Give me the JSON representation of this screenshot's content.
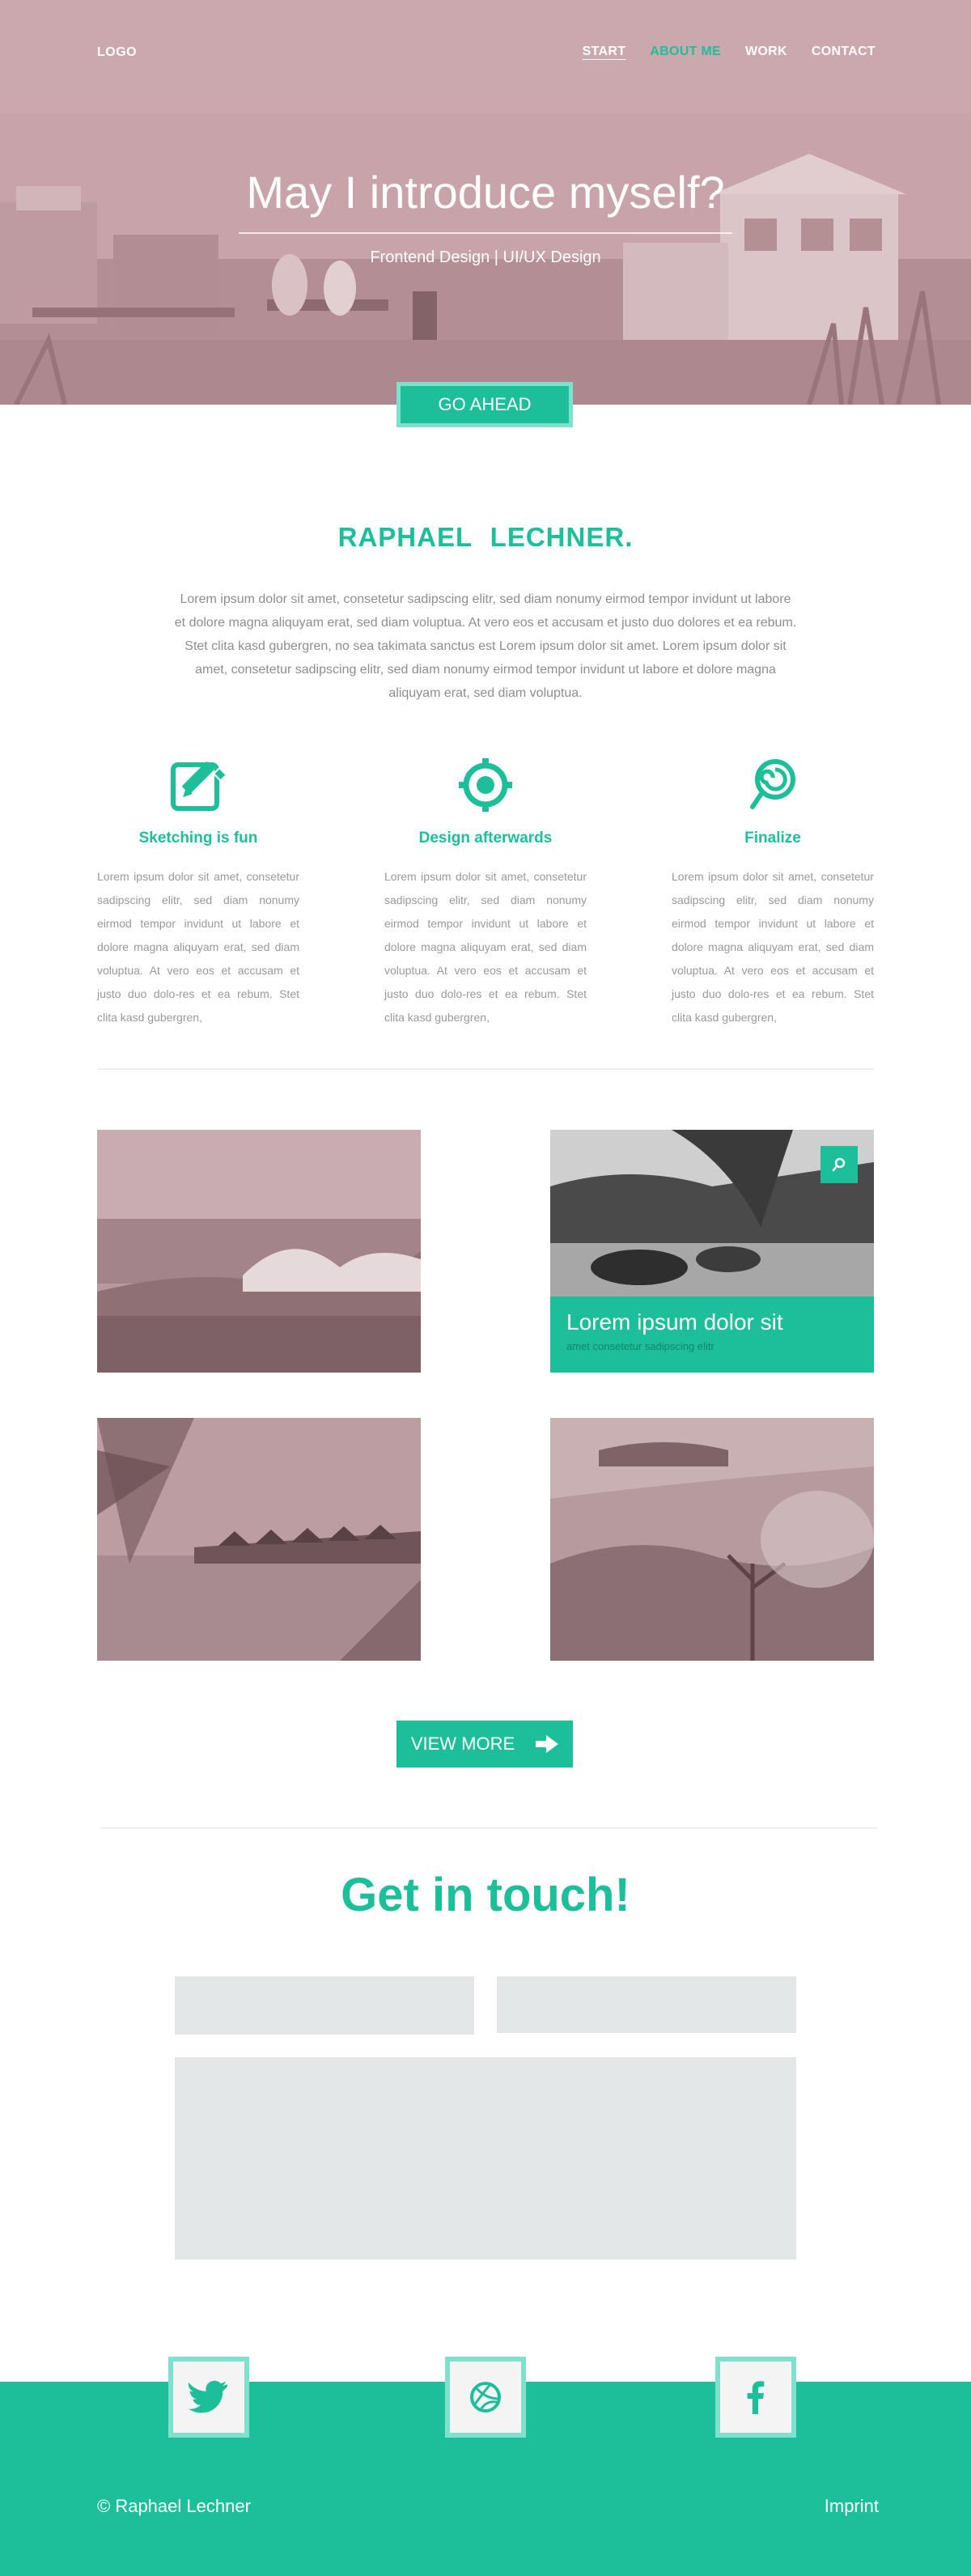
{
  "nav": {
    "logo": "LOGO",
    "items": [
      {
        "label": "START"
      },
      {
        "label": "ABOUT ME"
      },
      {
        "label": "WORK"
      },
      {
        "label": "CONTACT"
      }
    ]
  },
  "hero": {
    "title": "May I introduce myself?",
    "subtitle": "Frontend Design | UI/UX Design",
    "cta": "GO AHEAD"
  },
  "about": {
    "name": "RAPHAEL  LECHNER.",
    "intro": "Lorem ipsum dolor sit amet, consetetur sadipscing elitr, sed diam nonumy eirmod tempor invidunt ut labore et dolore magna aliquyam erat, sed diam voluptua. At vero eos et accusam et justo duo dolores et ea rebum. Stet clita kasd gubergren, no sea takimata sanctus est Lorem ipsum dolor sit amet. Lorem ipsum dolor sit amet, consetetur sadipscing elitr, sed diam nonumy eirmod tempor invidunt ut labore et dolore magna aliquyam erat, sed diam voluptua.",
    "features": [
      {
        "icon": "edit-icon",
        "title": "Sketching is fun",
        "text": "Lorem ipsum dolor sit amet, consetetur sadipscing elitr, sed diam nonumy eirmod tempor invidunt ut labore et dolore magna aliquyam erat, sed diam voluptua. At vero eos et accusam et justo duo dolo-res et ea rebum. Stet clita kasd gubergren,"
      },
      {
        "icon": "target-icon",
        "title": "Design afterwards",
        "text": "Lorem ipsum dolor sit amet, consetetur sadipscing elitr, sed diam nonumy eirmod tempor invidunt ut labore et dolore magna aliquyam erat, sed diam voluptua. At vero eos et accusam et justo duo dolo-res et ea rebum. Stet clita kasd gubergren,"
      },
      {
        "icon": "lollipop-icon",
        "title": "Finalize",
        "text": "Lorem ipsum dolor sit amet, consetetur sadipscing elitr, sed diam nonumy eirmod tempor invidunt ut labore et dolore magna aliquyam erat, sed diam voluptua. At vero eos et accusam et justo duo dolo-res et ea rebum. Stet clita kasd gubergren,"
      }
    ]
  },
  "portfolio": {
    "featured_title": "Lorem ipsum dolor sit",
    "featured_subtitle": "amet consetetur sadipscing elitr",
    "zoom_icon": "search-icon",
    "view_more": "VIEW MORE",
    "view_more_icon": "arrow-right-icon"
  },
  "contact": {
    "title": "Get in touch!"
  },
  "footer": {
    "social": [
      {
        "icon": "twitter-icon"
      },
      {
        "icon": "dribbble-icon"
      },
      {
        "icon": "facebook-icon"
      }
    ],
    "copyright": "© Raphael Lechner",
    "imprint": "Imprint"
  },
  "colors": {
    "accent": "#1dbf9a",
    "accent_light": "#7fe0cb",
    "field": "#e4e7e8",
    "text_gray": "#8e8e8e",
    "photo_tint": "#c8a2a8"
  }
}
